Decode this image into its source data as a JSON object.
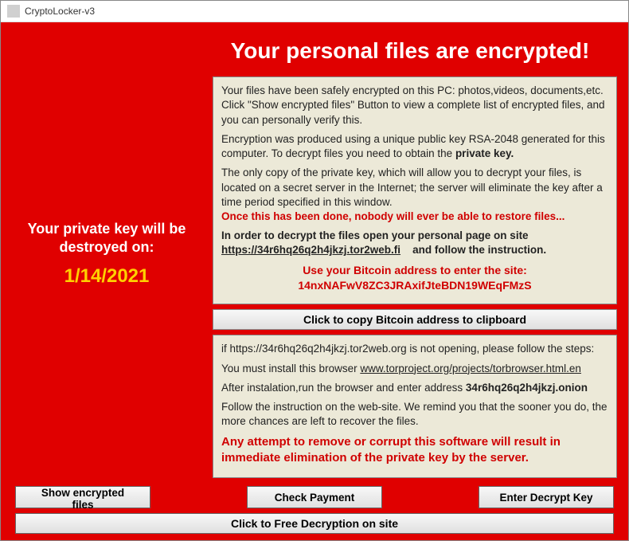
{
  "window": {
    "title": "CryptoLocker-v3"
  },
  "heading": "Your personal files are encrypted!",
  "left": {
    "warn_line1": "Your private key will be",
    "warn_line2": "destroyed on:",
    "date": "1/14/2021"
  },
  "panel1": {
    "p1": "Your files have been safely encrypted on this PC: photos,videos, documents,etc. Click \"Show encrypted files\" Button to view a complete list of encrypted files, and you can personally verify this.",
    "p2a": "Encryption was produced using a unique public key RSA-2048 generated for this computer. To decrypt files you need to obtain the ",
    "p2b": "private key.",
    "p3": "The only copy of the private key, which will allow you to decrypt your files, is located on a secret server in the Internet; the server will eliminate the key after a time period specified in this window.",
    "p3red": "Once this has been done, nobody will ever be able to restore files...",
    "p4": "In order to decrypt the files open your personal page on site",
    "p4url": "https://34r6hq26q2h4jkzj.tor2web.fi",
    "p4tail": "and follow the instruction.",
    "btc_line1": "Use your Bitcoin address to  enter the site:",
    "btc_addr": "14nxNAFwV8ZC3JRAxifJteBDN19WEqFMzS"
  },
  "copy_btn": "Click to copy Bitcoin address to clipboard",
  "panel2": {
    "p1": "if https://34r6hq26q2h4jkzj.tor2web.org is not opening, please follow the steps:",
    "p2a": "You must install this browser ",
    "p2url": "www.torproject.org/projects/torbrowser.html.en",
    "p3a": "After instalation,run the browser and enter address ",
    "p3addr": "34r6hq26q2h4jkzj.onion",
    "p4": "Follow the instruction on the web-site. We remind you that the  sooner you do, the more chances are left to recover the files.",
    "warn": "Any attempt to remove or corrupt this software will result in immediate elimination of the private key by the server."
  },
  "buttons": {
    "show": "Show encrypted files",
    "check": "Check Payment",
    "enter": "Enter Decrypt Key",
    "free": "Click to Free Decryption on site"
  }
}
